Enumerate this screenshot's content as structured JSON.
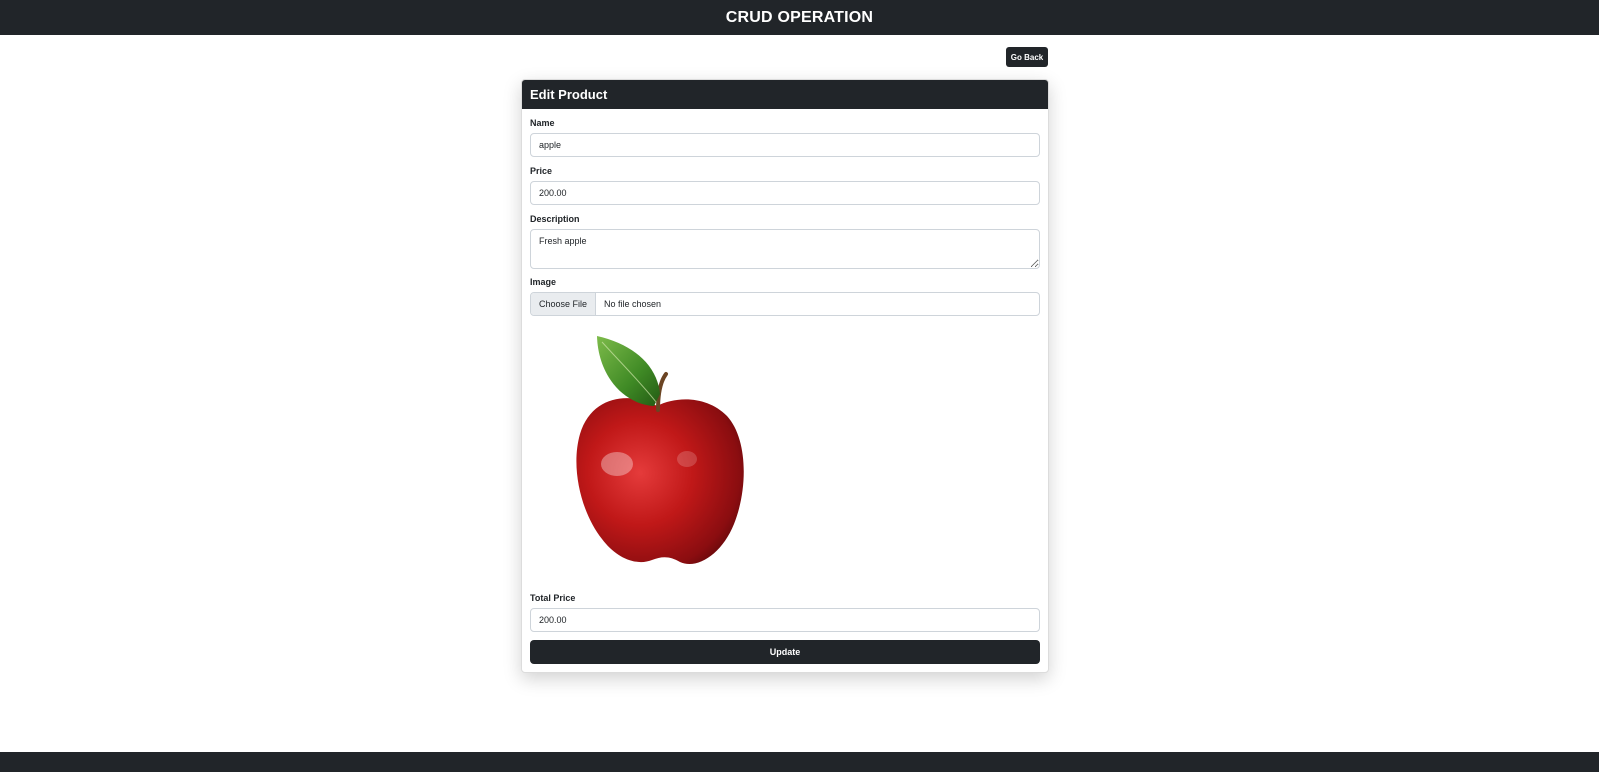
{
  "header": {
    "title": "CRUD OPERATION"
  },
  "actions": {
    "go_back_label": "Go Back"
  },
  "form": {
    "title": "Edit Product",
    "name": {
      "label": "Name",
      "value": "apple"
    },
    "price": {
      "label": "Price",
      "value": "200.00"
    },
    "description": {
      "label": "Description",
      "value": "Fresh apple"
    },
    "image": {
      "label": "Image",
      "button_label": "Choose File",
      "status": "No file chosen",
      "preview_icon": "apple-image"
    },
    "total_price": {
      "label": "Total Price",
      "value": "200.00"
    },
    "submit_label": "Update"
  },
  "colors": {
    "dark": "#212529",
    "border": "#ced4da",
    "file_button_bg": "#e9ecef"
  }
}
